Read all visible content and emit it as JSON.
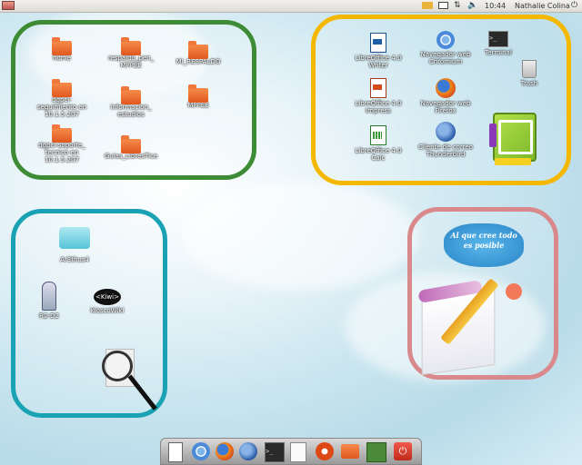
{
  "topbar": {
    "time": "10:44",
    "user": "Nathalie Colina"
  },
  "desktop_icons_green": [
    {
      "label": "home"
    },
    {
      "label": "respaldo_pen_ MPPEE"
    },
    {
      "label": "MI_RESPALDO"
    },
    {
      "label": "dgpcl-seguimiento en 10.1.5.207"
    },
    {
      "label": "informacion_ estudios"
    },
    {
      "label": "MPPEE"
    },
    {
      "label": "dgpcl-soporte_ tecnico en 10.1.5.207"
    },
    {
      "label": "Guias_LibresTice"
    }
  ],
  "desktop_icons_yellow": [
    {
      "label": "LibreOffice 4.0 Writer"
    },
    {
      "label": "Navegador web Chromium"
    },
    {
      "label": "Terminal"
    },
    {
      "label": "Trash"
    },
    {
      "label": "LibreOffice 4.0 Impress"
    },
    {
      "label": "Navegador web Firefox"
    },
    {
      "label": "LibreOffice 4.0 Calc"
    },
    {
      "label": "Cliente de correo Thunderbird"
    }
  ],
  "desktop_icons_teal": [
    {
      "label": "Ar3thus4"
    },
    {
      "label": "R2-D2"
    },
    {
      "label": "kioscoWiki"
    }
  ],
  "kiwix_logo": "<Kiwi>",
  "note_widget": {
    "text": "Al que cree todo es posible"
  },
  "colors": {
    "green": "#3d8c35",
    "yellow": "#f5b800",
    "teal": "#1aa2b4",
    "pink": "#d9898c"
  }
}
